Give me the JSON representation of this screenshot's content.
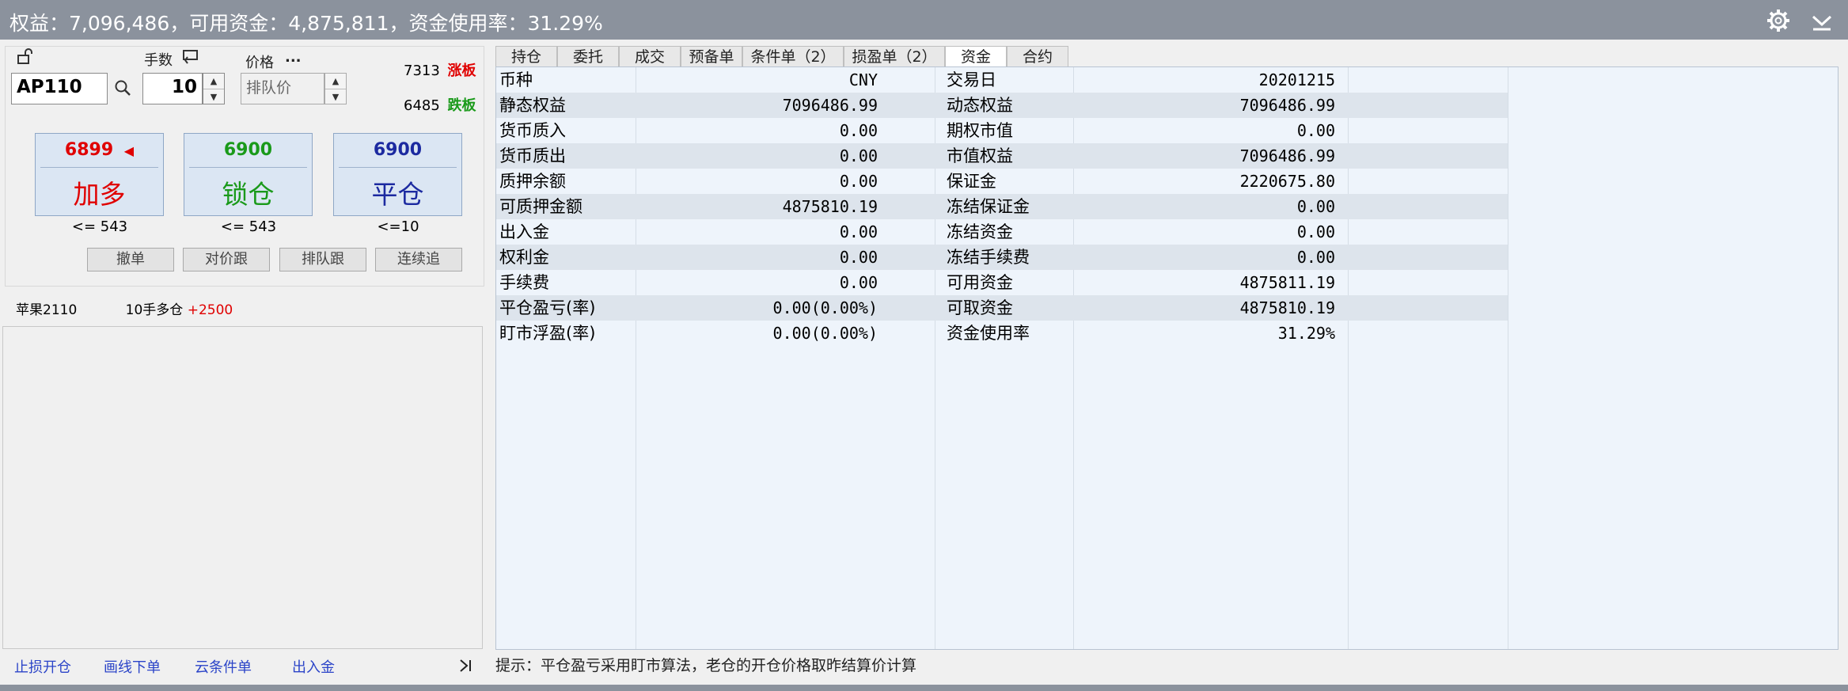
{
  "top_bar": {
    "summary": "权益：7,096,486，可用资金：4,875,811，资金使用率：31.29%",
    "gear_icon": "gear-icon",
    "collapse_icon": "chevron-down-bar-icon"
  },
  "order": {
    "lock_icon": "unlock-icon",
    "qty_label": "手数",
    "qty_icon": "return-icon",
    "price_label": "价格",
    "price_more": "...",
    "symbol": "AP110",
    "search_icon": "search-icon",
    "qty": "10",
    "price_mode": "排队价",
    "limit_up": {
      "value": "7313",
      "label": "涨板",
      "color": "#e00000"
    },
    "limit_down": {
      "value": "6485",
      "label": "跌板",
      "color": "#1a9a1a"
    },
    "buttons": [
      {
        "price": "6899",
        "marker": "◀",
        "action": "加多",
        "color": "#e00000",
        "limit": "<= 543"
      },
      {
        "price": "6900",
        "marker": "",
        "action": "锁仓",
        "color": "#1a9a1a",
        "limit": "<= 543"
      },
      {
        "price": "6900",
        "marker": "",
        "action": "平仓",
        "color": "#1c2aa0",
        "limit": "<=10"
      }
    ],
    "small_buttons": [
      "撤单",
      "对价跟",
      "排队跟",
      "连续追"
    ]
  },
  "position": {
    "name": "苹果2110",
    "desc": "10手多仓",
    "pnl": "+2500",
    "pnl_color": "#e00000"
  },
  "bottom_links": [
    "止损开仓",
    "画线下单",
    "云条件单",
    "出入金"
  ],
  "bottom_end_icon": "skip-end-icon",
  "tabs": [
    {
      "label": "持仓",
      "active": false
    },
    {
      "label": "委托",
      "active": false
    },
    {
      "label": "成交",
      "active": false
    },
    {
      "label": "预备单",
      "active": false
    },
    {
      "label": "条件单（2）",
      "active": false
    },
    {
      "label": "损盈单（2）",
      "active": false
    },
    {
      "label": "资金",
      "active": true
    },
    {
      "label": "合约",
      "active": false
    }
  ],
  "fund_table": [
    [
      "币种",
      "CNY",
      "交易日",
      "20201215"
    ],
    [
      "静态权益",
      "7096486.99",
      "动态权益",
      "7096486.99"
    ],
    [
      "货币质入",
      "0.00",
      "期权市值",
      "0.00"
    ],
    [
      "货币质出",
      "0.00",
      "市值权益",
      "7096486.99"
    ],
    [
      "质押余额",
      "0.00",
      "保证金",
      "2220675.80"
    ],
    [
      "可质押金额",
      "4875810.19",
      "冻结保证金",
      "0.00"
    ],
    [
      "出入金",
      "0.00",
      "冻结资金",
      "0.00"
    ],
    [
      "权利金",
      "0.00",
      "冻结手续费",
      "0.00"
    ],
    [
      "手续费",
      "0.00",
      "可用资金",
      "4875811.19"
    ],
    [
      "平仓盈亏(率)",
      "0.00(0.00%)",
      "可取资金",
      "4875810.19"
    ],
    [
      "盯市浮盈(率)",
      "0.00(0.00%)",
      "资金使用率",
      "31.29%"
    ]
  ],
  "hint": "提示：平仓盈亏采用盯市算法，老仓的开仓价格取昨结算价计算"
}
